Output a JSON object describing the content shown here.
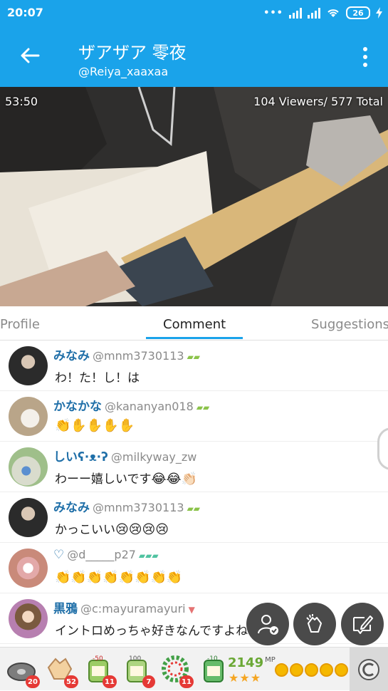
{
  "status_bar": {
    "time": "20:07",
    "battery": "26"
  },
  "header": {
    "title": "ザアザア 零夜",
    "handle": "@Reiya_xaaxaa"
  },
  "video": {
    "elapsed": "53:50",
    "viewers": "104 Viewers/ 577 Total"
  },
  "tabs": [
    {
      "label": "Profile",
      "active": false
    },
    {
      "label": "Comment",
      "active": true
    },
    {
      "label": "Suggestions",
      "active": false
    }
  ],
  "comments": [
    {
      "name": "みなみ",
      "handle": "@mnm3730113",
      "text": "わ！た！し！は",
      "emoji": "",
      "avatar_color": "#6b6b6b"
    },
    {
      "name": "かなかな",
      "handle": "@kananyan018",
      "text": "",
      "emoji": "👏✋✋✋✋",
      "avatar_color": "#c9b9a0"
    },
    {
      "name": "しいʕ·ᴥ·ʔ",
      "handle": "@milkyway_zw",
      "text": "わーー嬉しいです",
      "emoji": "😂😂👏🏻",
      "avatar_color": "#a8c6a0"
    },
    {
      "name": "みなみ",
      "handle": "@mnm3730113",
      "text": "かっこいい",
      "emoji": "😢😢😢😢",
      "avatar_color": "#6b6b6b"
    },
    {
      "name": "♡",
      "handle": "@d_____p27",
      "text": "",
      "emoji": "👏👏👏👏👏👏👏👏",
      "avatar_color": "#e7c2c2"
    },
    {
      "name": "黒鴉",
      "handle": "@c:mayuramayuri",
      "text": "イントロめっちゃ好きなんですよね",
      "emoji": "♪",
      "avatar_color": "#8a6d8f"
    }
  ],
  "gifts": [
    {
      "name": "disc",
      "count": "20"
    },
    {
      "name": "clap",
      "count": "52"
    },
    {
      "name": "tea-50",
      "count": "11"
    },
    {
      "name": "tea-100",
      "count": "7"
    },
    {
      "name": "wreath",
      "count": "11"
    },
    {
      "name": "tea-10",
      "count": ""
    }
  ],
  "wallet": {
    "mp_value": "2149",
    "mp_unit": "MP",
    "stars": "★★★"
  },
  "colors": {
    "accent": "#1aa3ea",
    "name_blue": "#1f6fa8"
  }
}
